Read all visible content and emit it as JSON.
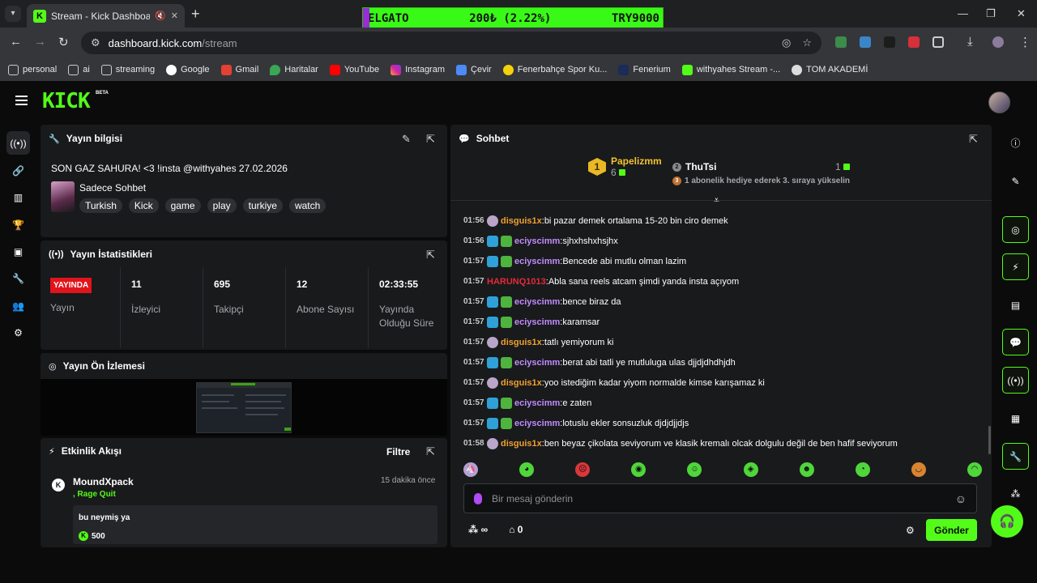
{
  "browser": {
    "tab_title": "Stream - Kick Dashboard",
    "url_host": "dashboard.kick.com",
    "url_path": "/stream",
    "bookmarks": [
      "personal",
      "ai",
      "streaming",
      "Google",
      "Gmail",
      "Haritalar",
      "YouTube",
      "Instagram",
      "Çevir",
      "Fenerbahçe Spor Ku...",
      "Fenerium",
      "withyahes Stream -...",
      "TOM AKADEMİ"
    ]
  },
  "ticker": {
    "left": "ELGATO",
    "center": "200₺ (2.22%)",
    "right": "TRY9000"
  },
  "app": {
    "logo": "KICK",
    "beta": "BETA"
  },
  "stream_info": {
    "header": "Yayın bilgisi",
    "title": "SON GAZ SAHURA! <3 !insta @withyahes 27.02.2026",
    "category": "Sadece Sohbet",
    "tags": [
      "Turkish",
      "Kick",
      "game",
      "play",
      "turkiye",
      "watch"
    ]
  },
  "stats": {
    "header": "Yayın İstatistikleri",
    "live_badge": "YAYINDA",
    "live_label": "Yayın",
    "viewers_value": "11",
    "viewers_label": "İzleyici",
    "followers_value": "695",
    "followers_label": "Takipçi",
    "subs_value": "12",
    "subs_label": "Abone Sayısı",
    "uptime_value": "02:33:55",
    "uptime_label": "Yayında Olduğu Süre"
  },
  "preview": {
    "header": "Yayın Ön İzlemesi"
  },
  "activity": {
    "header": "Etkinlik Akışı",
    "filter": "Filtre",
    "user": "MoundXpack",
    "action": ", Rage Quit",
    "time": "15 dakika önce",
    "message": "bu neymiş ya",
    "amount": "500"
  },
  "chat": {
    "header": "Sohbet",
    "leader1_name": "Papelizmm",
    "leader1_count": "6",
    "leader2_name": "ThuTsi",
    "leader2_count": "1",
    "leader2_status": "1 abonelik hediye ederek 3. sıraya yükselin",
    "messages": [
      {
        "time": "01:56",
        "user": "disguis1x",
        "color": "#f0a030",
        "text": "bi pazar demek ortalama 15-20 bin ciro demek",
        "badges": "av"
      },
      {
        "time": "01:56",
        "user": "eciyscimm",
        "color": "#c18cff",
        "text": "sjhxhshxhsjhx",
        "badges": "sub"
      },
      {
        "time": "01:57",
        "user": "eciyscimm",
        "color": "#c18cff",
        "text": "Bencede abi mutlu olman lazim",
        "badges": "sub"
      },
      {
        "time": "01:57",
        "user": "HARUNQ1013",
        "color": "#e22b3a",
        "text": "Abla sana reels atcam şimdi yanda insta açıyom",
        "badges": ""
      },
      {
        "time": "01:57",
        "user": "eciyscimm",
        "color": "#c18cff",
        "text": "bence biraz da",
        "badges": "sub"
      },
      {
        "time": "01:57",
        "user": "eciyscimm",
        "color": "#c18cff",
        "text": "karamsar",
        "badges": "sub"
      },
      {
        "time": "01:57",
        "user": "disguis1x",
        "color": "#f0a030",
        "text": "tatlı yemiyorum ki",
        "badges": "av"
      },
      {
        "time": "01:57",
        "user": "eciyscimm",
        "color": "#c18cff",
        "text": "berat abi tatli ye mutluluga ulas djjdjdhdhjdh",
        "badges": "sub"
      },
      {
        "time": "01:57",
        "user": "disguis1x",
        "color": "#f0a030",
        "text": "yoo istediğim kadar yiyom normalde kimse karışamaz ki",
        "badges": "av"
      },
      {
        "time": "01:57",
        "user": "eciyscimm",
        "color": "#c18cff",
        "text": "e zaten",
        "badges": "sub"
      },
      {
        "time": "01:57",
        "user": "eciyscimm",
        "color": "#c18cff",
        "text": "lotuslu ekler sonsuzluk djdjdjjdjs",
        "badges": "sub"
      },
      {
        "time": "01:58",
        "user": "disguis1x",
        "color": "#f0a030",
        "text": "ben beyaz çikolata seviyorum ve klasik kremalı olcak dolgulu değil de ben hafif seviyorum",
        "badges": "av"
      }
    ],
    "input_placeholder": "Bir mesaj gönderin",
    "points": "∞",
    "store_count": "0",
    "send": "Gönder"
  },
  "colors": {
    "accent": "#53fc18",
    "live": "#e1141b",
    "panel": "#191a1c"
  }
}
